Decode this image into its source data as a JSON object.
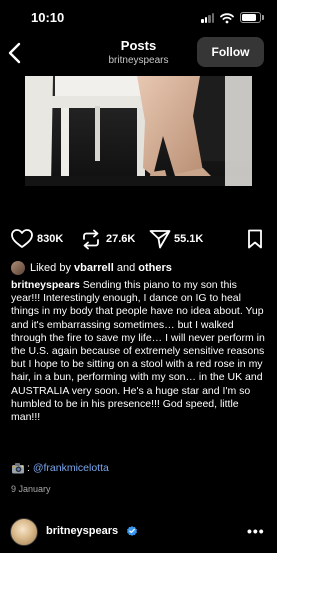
{
  "status_bar": {
    "time": "10:10"
  },
  "header": {
    "title": "Posts",
    "subtitle": "britneyspears",
    "follow_label": "Follow"
  },
  "actions": {
    "likes": "830K",
    "reposts": "27.6K",
    "shares": "55.1K"
  },
  "liked_by": {
    "prefix": "Liked by ",
    "user": "vbarrell",
    "middle": " and ",
    "others": "others"
  },
  "caption": {
    "username": "britneyspears",
    "text": " Sending this piano to my son this year!!! Interestingly enough, I dance on IG to heal things in my body that people have no idea about. Yup and it's embarrassing sometimes… but I walked through the fire to save my life… I will never perform in the U.S. again because of extremely sensitive reasons but I hope to be sitting on a stool with a red rose in my hair, in a bun, performing with my son… in the UK and AUSTRALIA very soon. He's a huge star and I'm so humbled to be in his presence!!! God speed, little man!!!"
  },
  "credit": {
    "colon": ": ",
    "handle": "@frankmicelotta"
  },
  "date": "9 January",
  "next_post": {
    "username": "britneyspears",
    "more": "•••"
  },
  "colors": {
    "background": "#000000",
    "follow_button": "#363636",
    "link": "#7aa7ee",
    "verified": "#3897f0",
    "muted": "#a8a8a8"
  },
  "icons": [
    "back-icon",
    "heart-icon",
    "repost-icon",
    "share-icon",
    "bookmark-icon",
    "camera-icon",
    "verified-icon",
    "more-icon"
  ]
}
